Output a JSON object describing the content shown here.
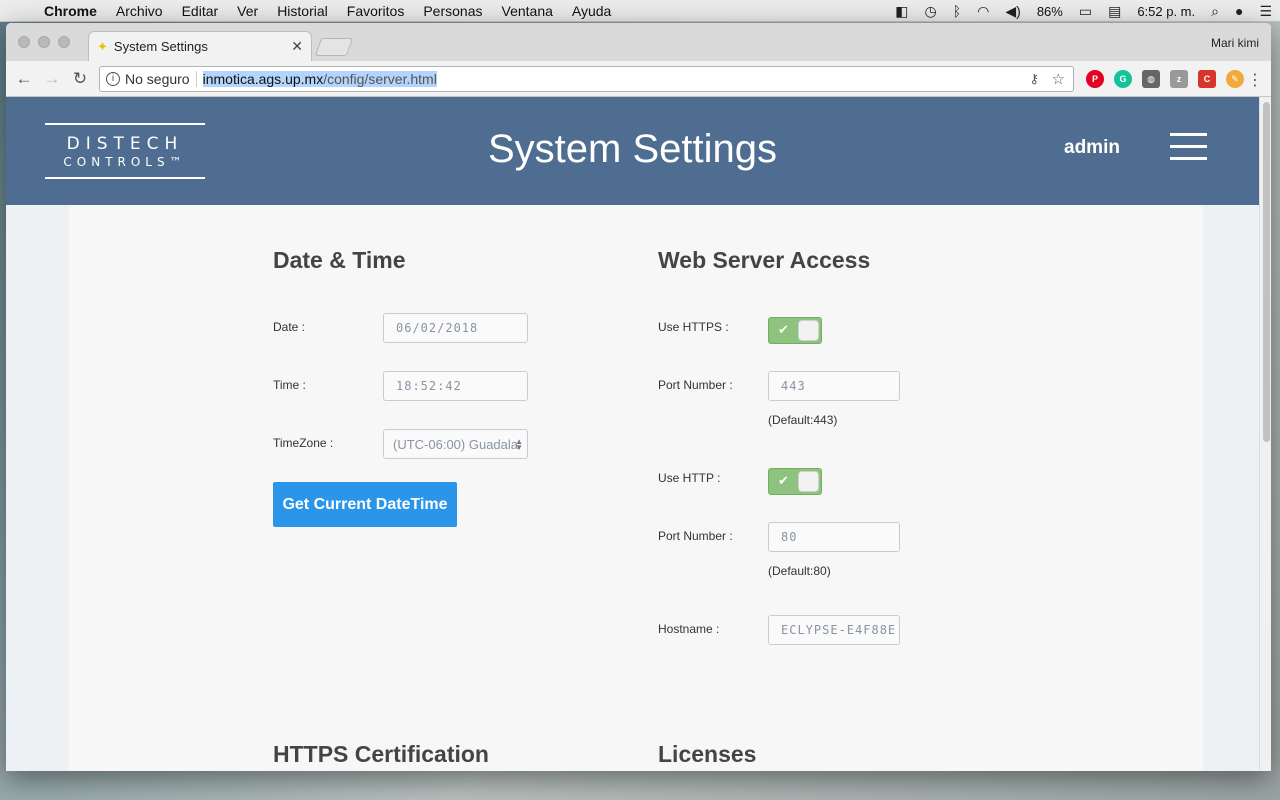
{
  "menubar": {
    "items": [
      "Chrome",
      "Archivo",
      "Editar",
      "Ver",
      "Historial",
      "Favoritos",
      "Personas",
      "Ventana",
      "Ayuda"
    ],
    "battery": "86%",
    "clock": "6:52 p. m."
  },
  "browser": {
    "tab_title": "System Settings",
    "profile_name": "Mari kimi",
    "security_label": "No seguro",
    "url_host": "inmotica.ags.up.mx",
    "url_path": "/config/server.html"
  },
  "header": {
    "logo_line1": "DISTECH",
    "logo_line2": "CONTROLS™",
    "title": "System Settings",
    "username": "admin"
  },
  "datetime": {
    "title": "Date & Time",
    "date_label": "Date :",
    "date_value": "06/02/2018",
    "time_label": "Time :",
    "time_value": "18:52:42",
    "timezone_label": "TimeZone :",
    "timezone_value": "(UTC-06:00) Guadala",
    "button_label": "Get Current DateTime"
  },
  "webserver": {
    "title": "Web Server Access",
    "https_label": "Use HTTPS :",
    "https_enabled": true,
    "https_port_label": "Port Number :",
    "https_port_value": "443",
    "https_default": "(Default:443)",
    "http_label": "Use HTTP :",
    "http_enabled": true,
    "http_port_label": "Port Number :",
    "http_port_value": "80",
    "http_default": "(Default:80)",
    "hostname_label": "Hostname :",
    "hostname_value": "ECLYPSE-E4F88E"
  },
  "sections": {
    "https_cert_title": "HTTPS Certification",
    "licenses_title": "Licenses"
  },
  "colors": {
    "header_bg": "#4f6d91",
    "button_blue": "#2b95e9",
    "toggle_green": "#8dc37f"
  }
}
